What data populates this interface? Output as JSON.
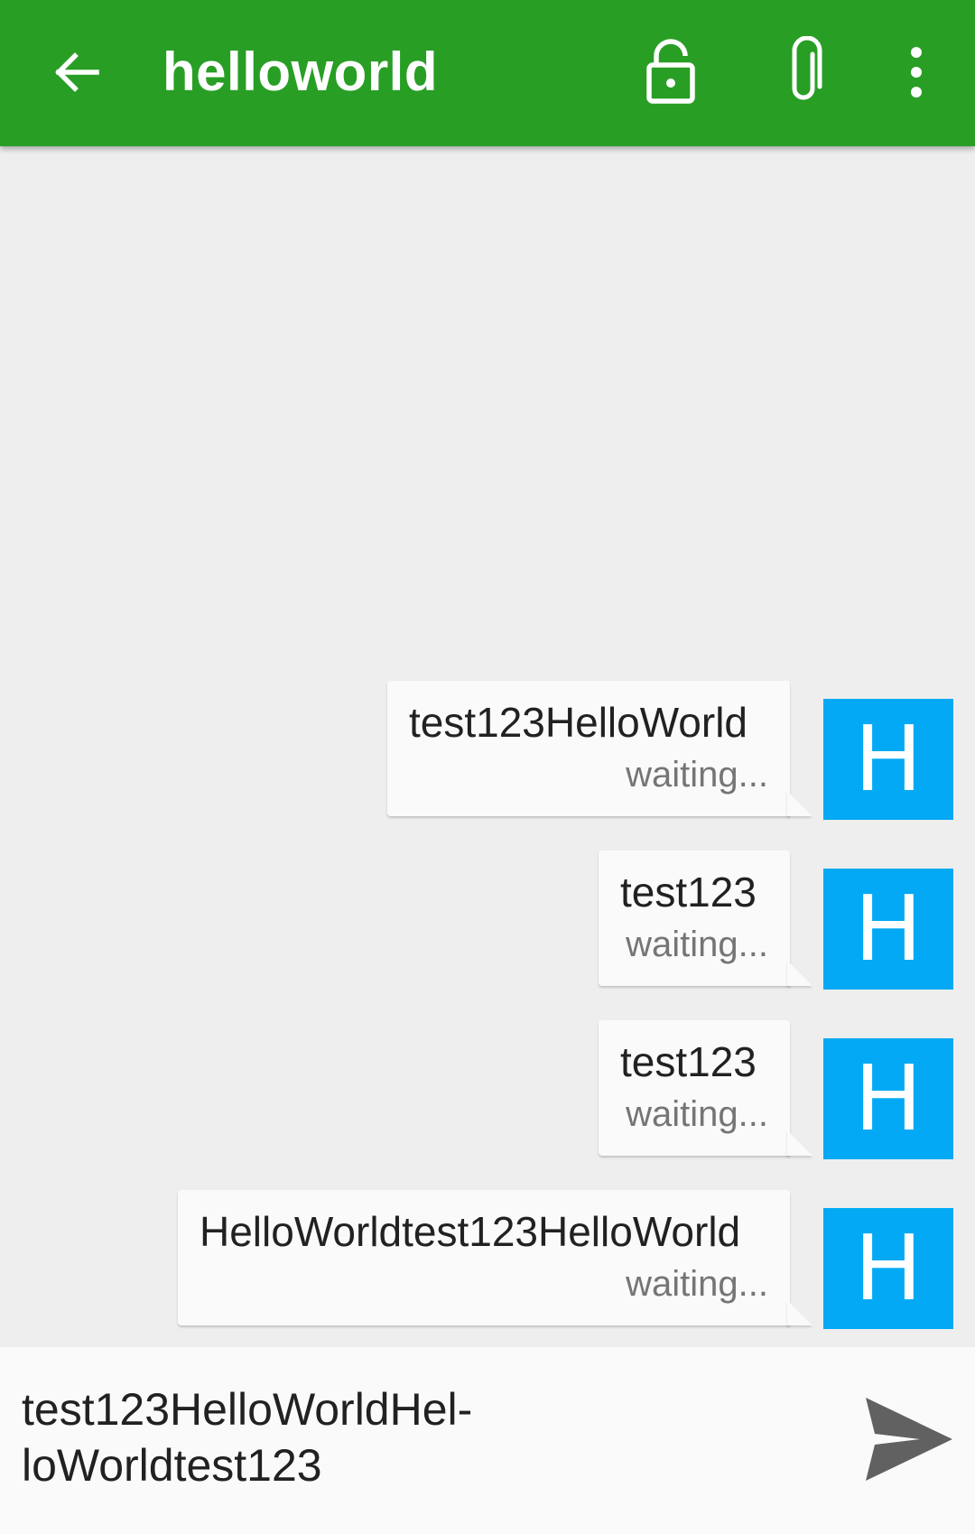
{
  "toolbar": {
    "title": "helloworld",
    "background": "#289e25",
    "icons": [
      "back-arrow-icon",
      "lock-open-icon",
      "paperclip-icon",
      "more-vert-icon"
    ]
  },
  "messages": [
    {
      "text": "test123HelloWorld",
      "status": "waiting...",
      "avatar": "H"
    },
    {
      "text": "test123",
      "status": "waiting...",
      "avatar": "H"
    },
    {
      "text": "test123",
      "status": "waiting...",
      "avatar": "H"
    },
    {
      "text": "HelloWorldtest123HelloWorld",
      "status": "waiting...",
      "avatar": "H"
    }
  ],
  "avatar_color": "#03a9f4",
  "composer": {
    "value": "test123HelloWorldHel-\nloWorldtest123",
    "send_icon": "send-icon"
  }
}
